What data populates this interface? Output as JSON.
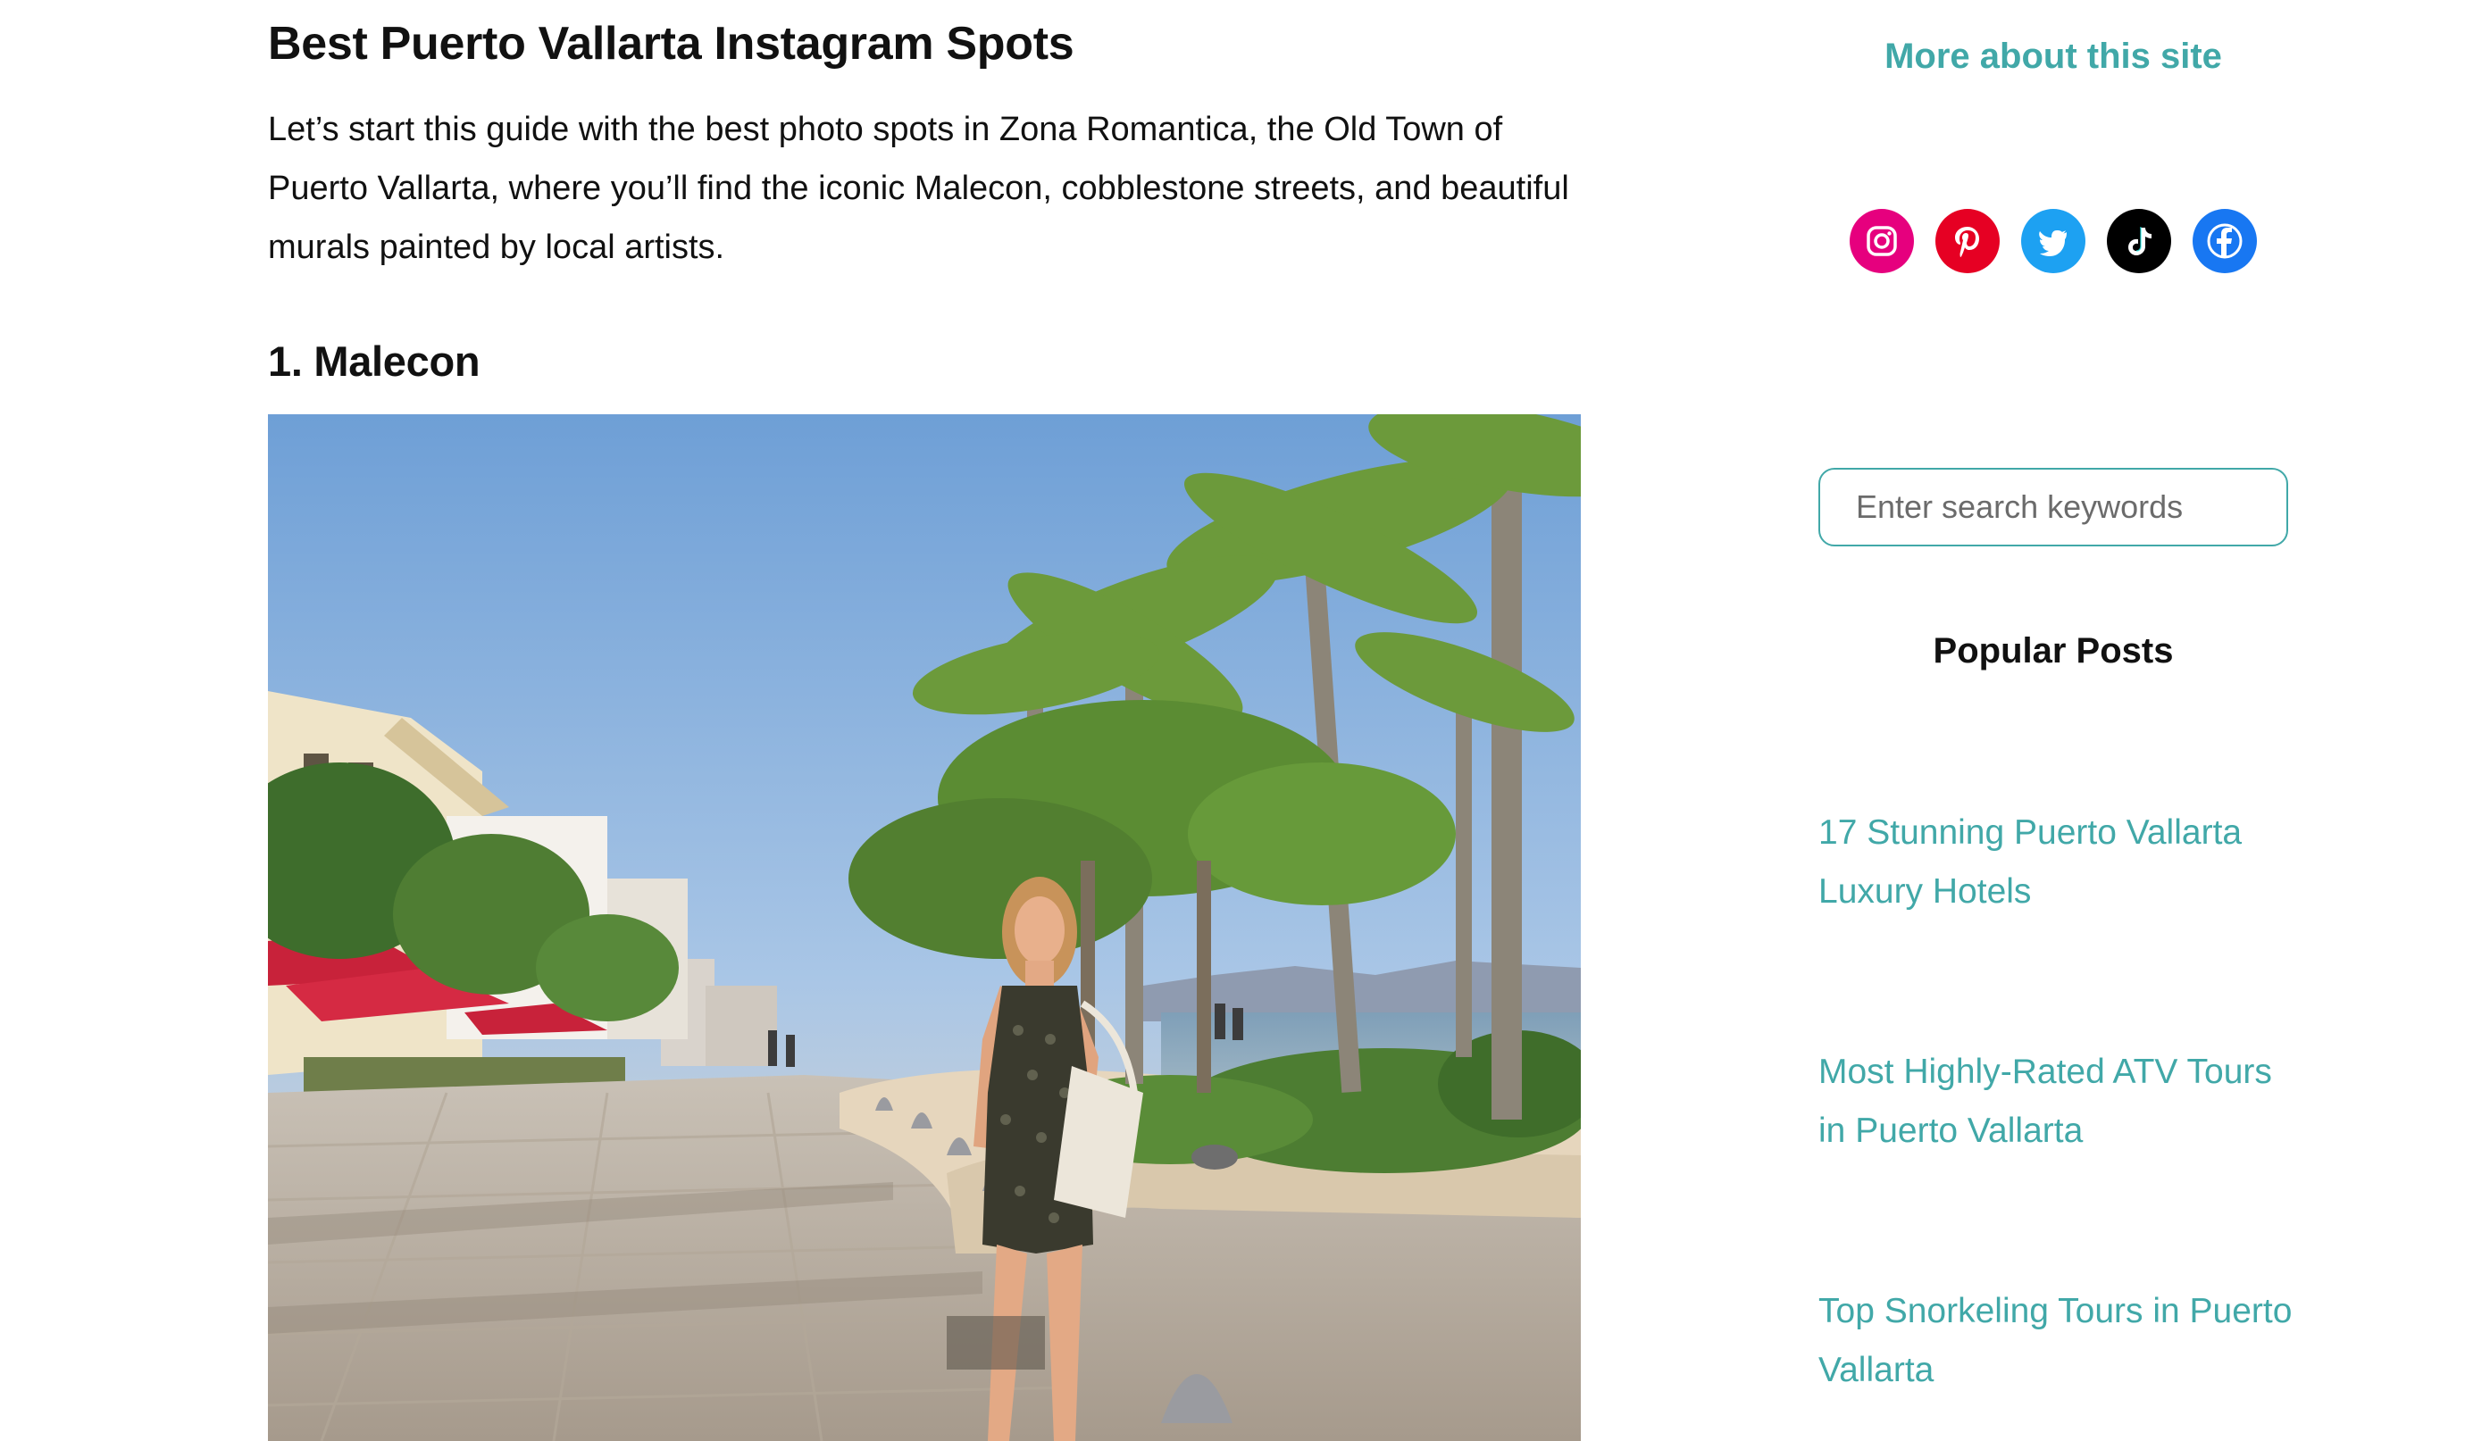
{
  "article": {
    "title": "Best Puerto Vallarta Instagram Spots",
    "intro": "Let’s start this guide with the best photo spots in Zona Romantica, the Old Town of Puerto Vallarta, where you’ll find the iconic Malecon, cobblestone streets, and beautiful murals painted by local artists.",
    "section_heading": "1. Malecon"
  },
  "sidebar": {
    "more_about": "More about this site",
    "socials": [
      {
        "name": "instagram-icon",
        "color": "#e6007e"
      },
      {
        "name": "pinterest-icon",
        "color": "#e60023"
      },
      {
        "name": "twitter-icon",
        "color": "#1da1f2"
      },
      {
        "name": "tiktok-icon",
        "color": "#000000"
      },
      {
        "name": "facebook-icon",
        "color": "#1877f2"
      }
    ],
    "search": {
      "placeholder": "Enter search keywords",
      "value": ""
    },
    "popular_title": "Popular Posts",
    "posts": [
      {
        "label": "17 Stunning Puerto Vallarta Luxury Hotels"
      },
      {
        "label": "Most Highly-Rated ATV Tours in Puerto Vallarta"
      },
      {
        "label": "Top Snorkeling Tours in Puerto Vallarta"
      }
    ]
  },
  "colors": {
    "accent": "#41a8a8",
    "text": "#111111"
  }
}
